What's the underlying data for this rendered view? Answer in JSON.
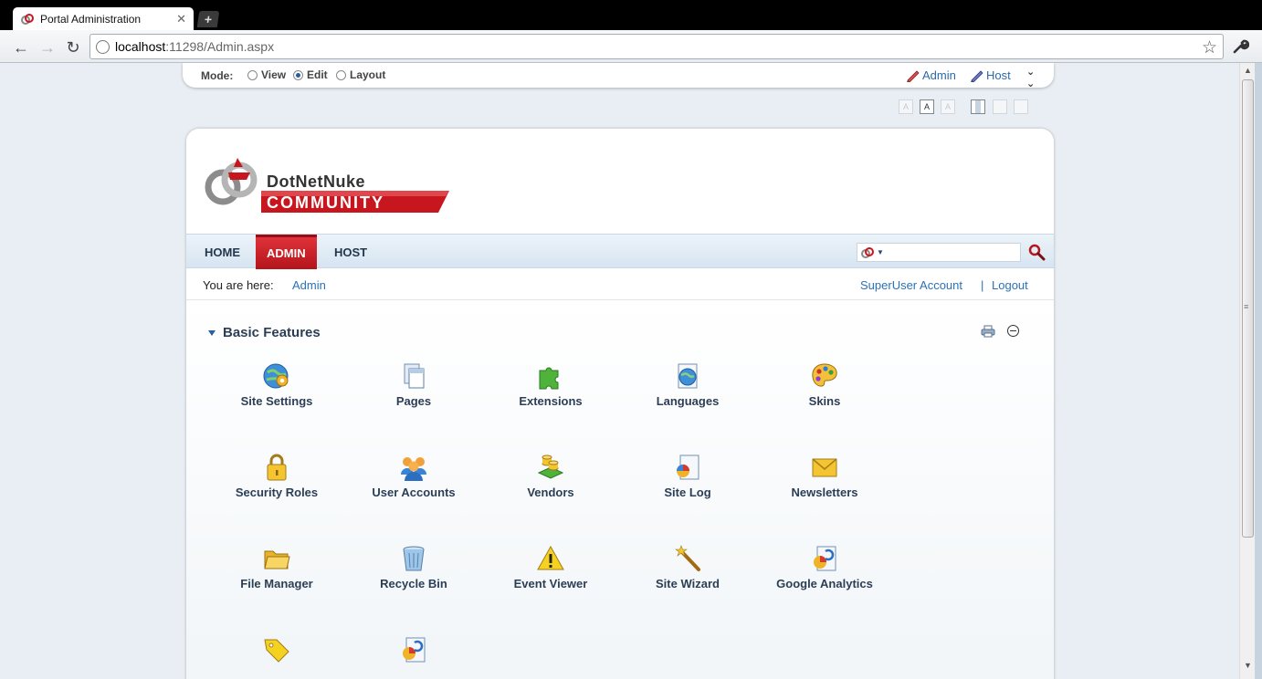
{
  "browser": {
    "tab_title": "Portal Administration",
    "new_tab_label": "+",
    "url_host": "localhost",
    "url_rest": ":11298/Admin.aspx"
  },
  "control_panel": {
    "mode_label": "Mode:",
    "modes": [
      {
        "label": "View",
        "checked": false
      },
      {
        "label": "Edit",
        "checked": true
      },
      {
        "label": "Layout",
        "checked": false
      }
    ],
    "admin_link": "Admin",
    "host_link": "Host",
    "font_size_buttons": [
      "A",
      "A",
      "A"
    ]
  },
  "menu": {
    "items": [
      "HOME",
      "ADMIN",
      "HOST"
    ],
    "active": "ADMIN"
  },
  "breadcrumb": {
    "label": "You are here:",
    "link": "Admin"
  },
  "user": {
    "account": "SuperUser Account",
    "separator": "|",
    "logout": "Logout"
  },
  "module": {
    "title": "Basic Features",
    "items": [
      {
        "label": "Site Settings",
        "icon": "site-settings-icon"
      },
      {
        "label": "Pages",
        "icon": "pages-icon"
      },
      {
        "label": "Extensions",
        "icon": "puzzle-icon"
      },
      {
        "label": "Languages",
        "icon": "languages-icon"
      },
      {
        "label": "Skins",
        "icon": "palette-icon"
      },
      {
        "label": "Security Roles",
        "icon": "padlock-icon"
      },
      {
        "label": "User Accounts",
        "icon": "users-icon"
      },
      {
        "label": "Vendors",
        "icon": "vendors-icon"
      },
      {
        "label": "Site Log",
        "icon": "site-log-icon"
      },
      {
        "label": "Newsletters",
        "icon": "envelope-icon"
      },
      {
        "label": "File Manager",
        "icon": "folder-icon"
      },
      {
        "label": "Recycle Bin",
        "icon": "recycle-bin-icon"
      },
      {
        "label": "Event Viewer",
        "icon": "warning-icon"
      },
      {
        "label": "Site Wizard",
        "icon": "magic-wand-icon"
      },
      {
        "label": "Google Analytics",
        "icon": "analytics-icon"
      },
      {
        "label": "",
        "icon": "tag-icon"
      },
      {
        "label": "",
        "icon": "analytics-icon"
      }
    ]
  },
  "colors": {
    "accent_red": "#c8161e",
    "link_blue": "#2b72b5",
    "heading_navy": "#2c3e55"
  }
}
